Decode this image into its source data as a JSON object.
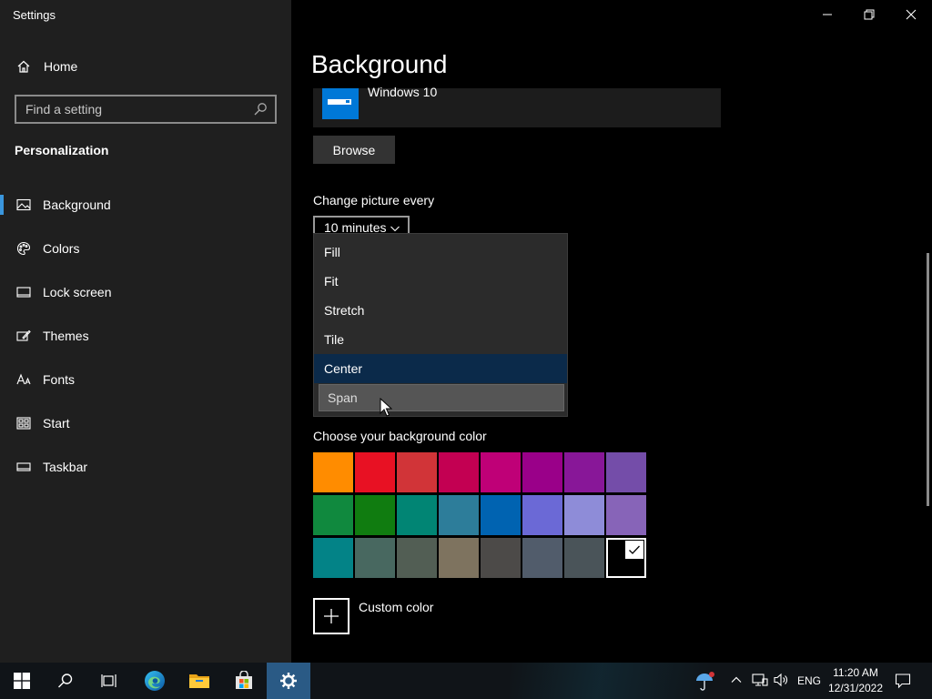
{
  "window": {
    "title": "Settings",
    "minimize_icon": "minimize-icon",
    "restore_icon": "restore-icon",
    "close_icon": "close-icon"
  },
  "sidebar": {
    "home_label": "Home",
    "search_placeholder": "Find a setting",
    "section_title": "Personalization",
    "items": [
      {
        "label": "Background",
        "icon": "picture-icon",
        "active": true
      },
      {
        "label": "Colors",
        "icon": "palette-icon",
        "active": false
      },
      {
        "label": "Lock screen",
        "icon": "lock-screen-icon",
        "active": false
      },
      {
        "label": "Themes",
        "icon": "themes-icon",
        "active": false
      },
      {
        "label": "Fonts",
        "icon": "fonts-icon",
        "active": false
      },
      {
        "label": "Start",
        "icon": "start-icon",
        "active": false
      },
      {
        "label": "Taskbar",
        "icon": "taskbar-icon",
        "active": false
      }
    ],
    "accent_color": "#3a96dd"
  },
  "main": {
    "page_title": "Background",
    "wallpaper_name": "Windows 10",
    "browse_label": "Browse",
    "change_picture_label": "Change picture every",
    "interval_value": "10 minutes",
    "fit_options": [
      "Fill",
      "Fit",
      "Stretch",
      "Tile",
      "Center",
      "Span"
    ],
    "fit_selected": "Center",
    "fit_hovered": "Span",
    "bg_color_label": "Choose your background color",
    "swatches": [
      "#ff8c00",
      "#e81123",
      "#d13438",
      "#c30052",
      "#bf0077",
      "#9a0089",
      "#881798",
      "#744da9",
      "#10893e",
      "#107c10",
      "#018574",
      "#2d7d9a",
      "#0063b1",
      "#6b69d6",
      "#8e8cd8",
      "#8764b8",
      "#038387",
      "#486860",
      "#525e54",
      "#7e735f",
      "#4c4a48",
      "#515c6b",
      "#4a5459",
      "#000000"
    ],
    "selected_swatch_index": 23,
    "custom_color_label": "Custom color"
  },
  "taskbar": {
    "buttons": [
      {
        "name": "start-button",
        "icon": "windows-logo-icon"
      },
      {
        "name": "search-button",
        "icon": "search-icon"
      },
      {
        "name": "task-view-button",
        "icon": "task-view-icon"
      },
      {
        "name": "edge-button",
        "icon": "edge-icon"
      },
      {
        "name": "file-explorer-button",
        "icon": "folder-icon"
      },
      {
        "name": "store-button",
        "icon": "store-icon"
      },
      {
        "name": "settings-button",
        "icon": "gear-icon",
        "active": true
      }
    ],
    "tray": {
      "language": "ENG",
      "time": "11:20 AM",
      "date": "12/31/2022"
    },
    "active_color": "#2a5a85"
  }
}
